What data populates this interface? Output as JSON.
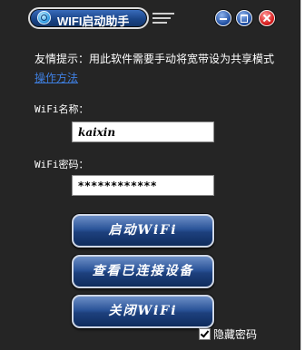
{
  "window": {
    "title": "WIFI启动助手",
    "icons": {
      "app": "wifi-logo-icon",
      "grip": "menu-lines-icon",
      "min": "minimize-icon",
      "restore": "restore-icon",
      "close": "close-icon"
    }
  },
  "notice": {
    "text": "友情提示：用此软件需要手动将宽带设为共享模式",
    "link": "操作方法"
  },
  "form": {
    "wifi_name_label": "WiFi名称：",
    "wifi_name_value": "kaixin",
    "wifi_password_label": "WiFi密码：",
    "wifi_password_value": "************"
  },
  "buttons": {
    "start": "启动WiFi",
    "view_devices": "查看已连接设备",
    "stop": "关闭WiFi"
  },
  "options": {
    "hide_password_label": "隐藏密码",
    "hide_password_checked": true
  },
  "colors": {
    "window_bg": "#252525",
    "button_blue": "#2b5499",
    "link_blue": "#3f7fe0"
  }
}
